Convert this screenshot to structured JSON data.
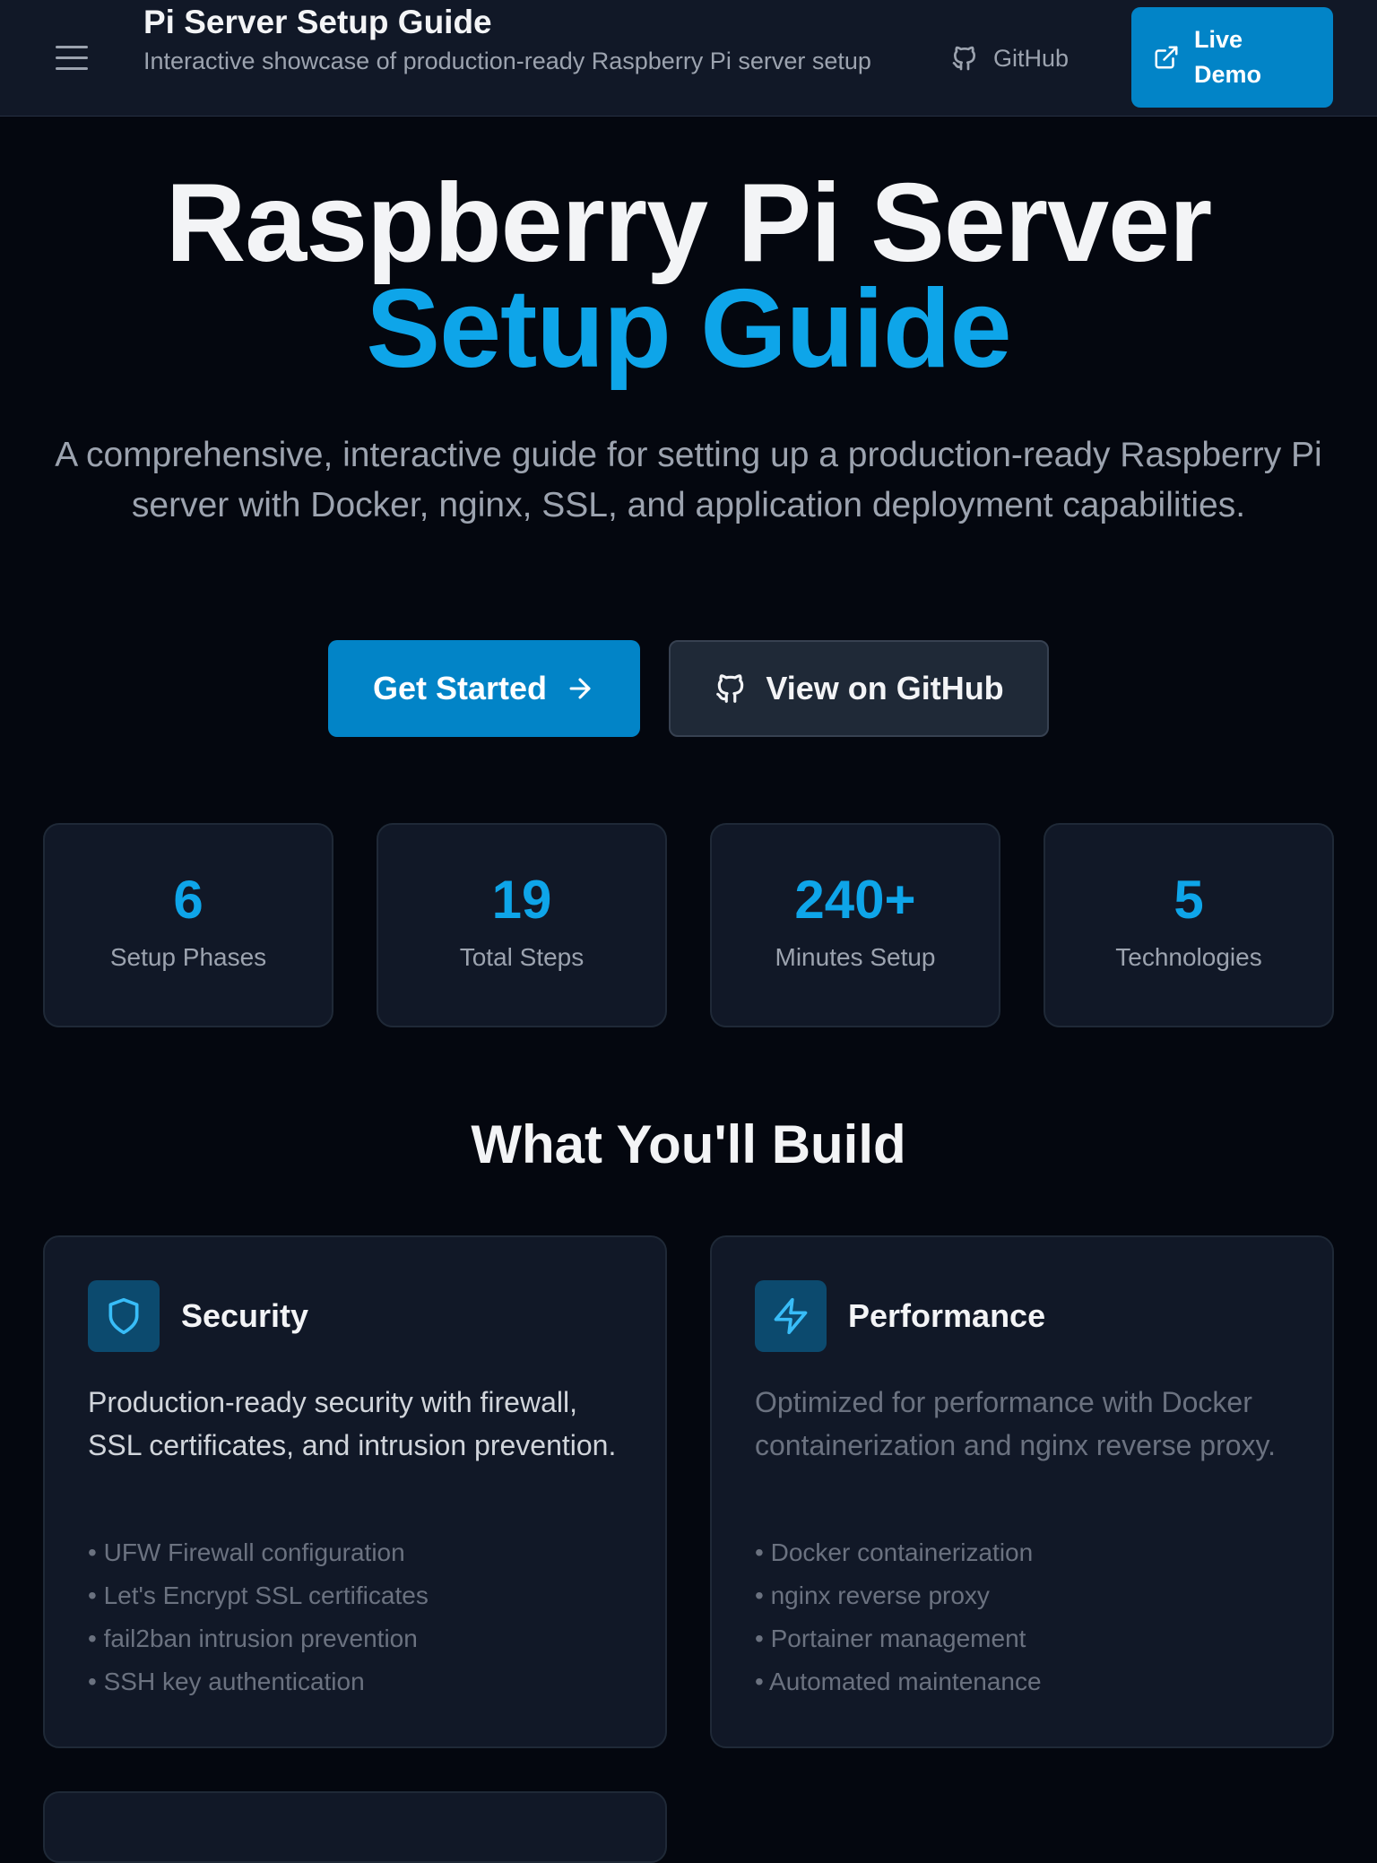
{
  "header": {
    "title": "Pi Server Setup Guide",
    "subtitle": "Interactive showcase of production-ready Raspberry Pi server setup",
    "github_label": "GitHub",
    "live_demo_label": "Live Demo"
  },
  "hero": {
    "title_line1": "Raspberry Pi Server",
    "title_line2": "Setup Guide",
    "description": "A comprehensive, interactive guide for setting up a production-ready Raspberry Pi server with Docker, nginx, SSL, and application deployment capabilities.",
    "primary_cta": "Get Started",
    "secondary_cta": "View on GitHub"
  },
  "stats": [
    {
      "value": "6",
      "label": "Setup Phases"
    },
    {
      "value": "19",
      "label": "Total Steps"
    },
    {
      "value": "240+",
      "label": "Minutes Setup"
    },
    {
      "value": "5",
      "label": "Technologies"
    }
  ],
  "build": {
    "heading": "What You'll Build",
    "cards": [
      {
        "icon": "shield-icon",
        "title": "Security",
        "description": "Production-ready security with firewall, SSL certificates, and intrusion prevention.",
        "features": [
          "UFW Firewall configuration",
          "Let's Encrypt SSL certificates",
          "fail2ban intrusion prevention",
          "SSH key authentication"
        ]
      },
      {
        "icon": "lightning-icon",
        "title": "Performance",
        "description": "Optimized for performance with Docker containerization and nginx reverse proxy.",
        "features": [
          "Docker containerization",
          "nginx reverse proxy",
          "Portainer management",
          "Automated maintenance"
        ]
      }
    ]
  },
  "colors": {
    "background": "#04070f",
    "surface": "#111827",
    "accent": "#0ea5e9",
    "button": "#0284c7"
  }
}
